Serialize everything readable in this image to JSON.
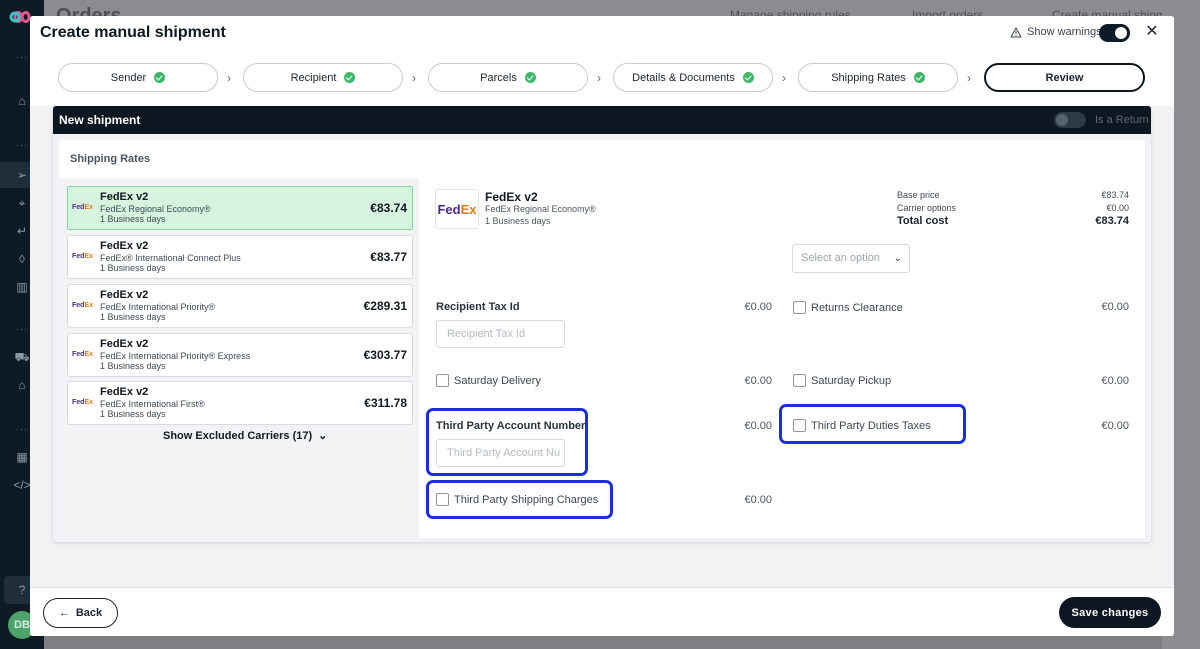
{
  "background": {
    "page_title": "Orders",
    "links": [
      "Manage shipping rules",
      "Import orders",
      "Create manual shipment"
    ],
    "avatar_initials": "DB"
  },
  "modal": {
    "title": "Create manual shipment",
    "show_warnings_label": "Show warnings",
    "show_warnings_on": true
  },
  "steps": [
    {
      "label": "Sender",
      "done": true
    },
    {
      "label": "Recipient",
      "done": true
    },
    {
      "label": "Parcels",
      "done": true
    },
    {
      "label": "Details & Documents",
      "done": true
    },
    {
      "label": "Shipping Rates",
      "done": true
    },
    {
      "label": "Review",
      "done": false,
      "current": true
    }
  ],
  "shipment": {
    "title": "New shipment",
    "is_return_label": "Is a Return",
    "is_return_on": false
  },
  "rates": {
    "section_title": "Shipping Rates",
    "items": [
      {
        "carrier": "FedEx v2",
        "service": "FedEx Regional Economy®",
        "days": "1 Business days",
        "price": "€83.74",
        "selected": true
      },
      {
        "carrier": "FedEx v2",
        "service": "FedEx® International Connect Plus",
        "days": "1 Business days",
        "price": "€83.77"
      },
      {
        "carrier": "FedEx v2",
        "service": "FedEx International Priority®",
        "days": "1 Business days",
        "price": "€289.31"
      },
      {
        "carrier": "FedEx v2",
        "service": "FedEx International Priority® Express",
        "days": "1 Business days",
        "price": "€303.77"
      },
      {
        "carrier": "FedEx v2",
        "service": "FedEx International First®",
        "days": "1 Business days",
        "price": "€311.78"
      }
    ],
    "logo_text_fed": "Fed",
    "logo_text_ex": "Ex",
    "excluded_label": "Show Excluded Carriers (17)"
  },
  "detail": {
    "carrier": "FedEx v2",
    "service": "FedEx Regional Economy®",
    "days": "1 Business days",
    "base_price_label": "Base price",
    "base_price": "€83.74",
    "carrier_options_label": "Carrier options",
    "carrier_options": "€0.00",
    "total_label": "Total cost",
    "total": "€83.74",
    "select_placeholder": "Select an option"
  },
  "options": {
    "recipient_tax_label": "Recipient Tax Id",
    "recipient_tax_placeholder": "Recipient Tax Id",
    "recipient_tax_price": "€0.00",
    "returns_clearance_label": "Returns Clearance",
    "returns_clearance_price": "€0.00",
    "saturday_delivery_label": "Saturday Delivery",
    "saturday_delivery_price": "€0.00",
    "saturday_pickup_label": "Saturday Pickup",
    "saturday_pickup_price": "€0.00",
    "third_party_account_label": "Third Party Account Number",
    "third_party_account_placeholder": "Third Party Account Nu",
    "third_party_account_price": "€0.00",
    "third_party_duties_label": "Third Party Duties Taxes",
    "third_party_duties_price": "€0.00",
    "third_party_shipping_label": "Third Party Shipping Charges",
    "third_party_shipping_price": "€0.00"
  },
  "footer": {
    "back_label": "Back",
    "save_label": "Save changes"
  },
  "colors": {
    "primary_dark": "#0c1721",
    "success": "#3fb86a",
    "selected_rate_bg": "#d7f5de",
    "highlight": "#1b2fdc"
  }
}
